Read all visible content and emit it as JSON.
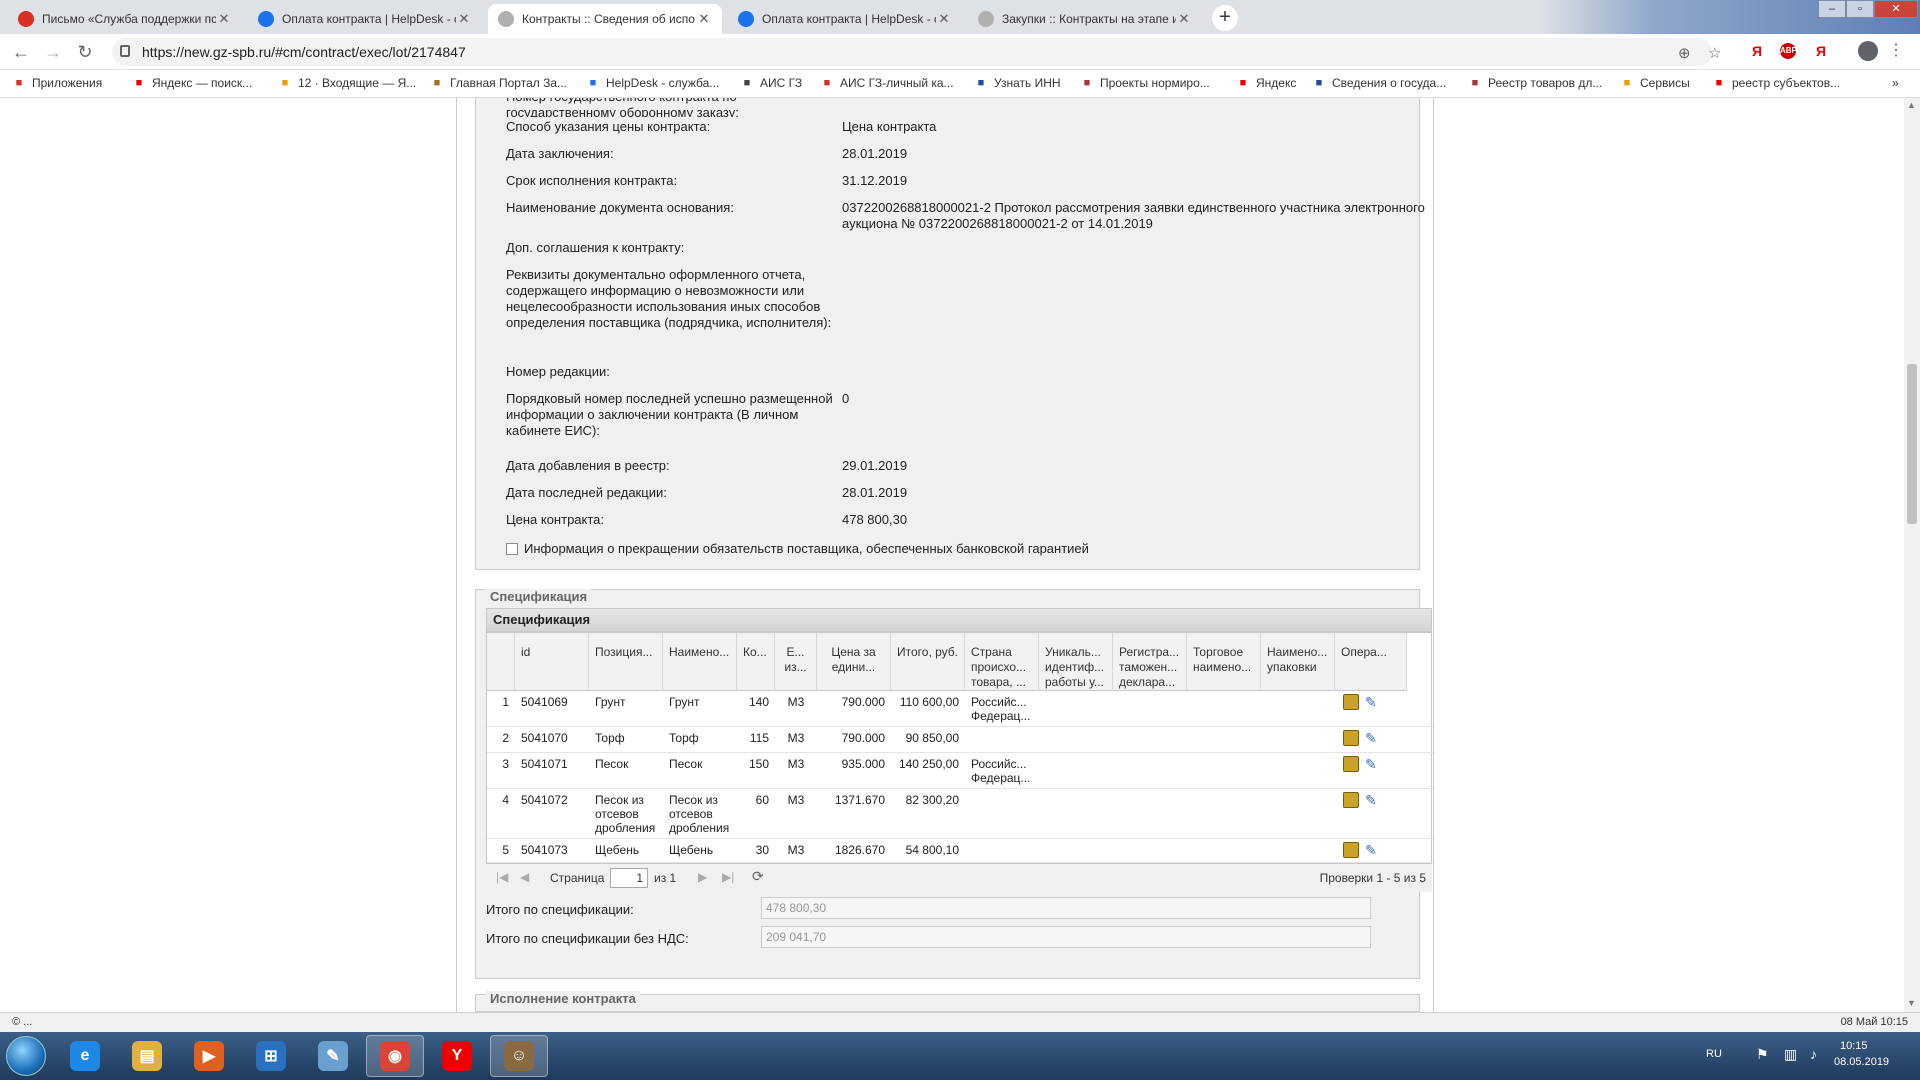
{
  "browser": {
    "tabs": [
      {
        "title": "Письмо «Служба поддержки пс",
        "icon_color": "#d93025",
        "icon": "mail-icon",
        "active": false
      },
      {
        "title": "Оплата контракта | HelpDesk - с",
        "icon_color": "#1a73e8",
        "icon": "helpdesk-icon",
        "active": false
      },
      {
        "title": "Контракты :: Сведения об испо",
        "icon_color": "#b0b0b0",
        "icon": "gz-icon",
        "active": true
      },
      {
        "title": "Оплата контракта | HelpDesk - с",
        "icon_color": "#1a73e8",
        "icon": "helpdesk-icon",
        "active": false
      },
      {
        "title": "Закупки :: Контракты на этапе и",
        "icon_color": "#b0b0b0",
        "icon": "gz-icon",
        "active": false
      }
    ],
    "new_tab": "+",
    "url": "https://new.gz-spb.ru/#cm/contract/exec/lot/2174847",
    "ext_labels": [
      "Я",
      "ABP",
      "Я"
    ],
    "bookmarks": [
      {
        "label": "Приложения",
        "icon": "apps-icon",
        "color": "#d93025"
      },
      {
        "label": "Яндекс — поиск...",
        "icon": "yandex-icon",
        "color": "#e00"
      },
      {
        "label": "12 · Входящие — Я...",
        "icon": "mail-icon",
        "color": "#e8a000"
      },
      {
        "label": "Главная Портал За...",
        "icon": "emblem-icon",
        "color": "#a07020"
      },
      {
        "label": "HelpDesk - служба...",
        "icon": "helpdesk-icon",
        "color": "#1a73e8"
      },
      {
        "label": "АИС ГЗ",
        "icon": "refresh-icon",
        "color": "#444"
      },
      {
        "label": "АИС ГЗ-личный ка...",
        "icon": "gz-icon",
        "color": "#c33"
      },
      {
        "label": "Узнать ИНН",
        "icon": "nalog-icon",
        "color": "#1a4f9c"
      },
      {
        "label": "Проекты нормиро...",
        "icon": "doc-icon",
        "color": "#a33"
      },
      {
        "label": "Яндекс",
        "icon": "yandex-icon",
        "color": "#e00"
      },
      {
        "label": "Сведения о госуда...",
        "icon": "globe-icon",
        "color": "#1a4f9c"
      },
      {
        "label": "Реестр товаров дл...",
        "icon": "registry-icon",
        "color": "#a33"
      },
      {
        "label": "Сервисы",
        "icon": "apps-icon",
        "color": "#e8a000"
      },
      {
        "label": "реестр субъектов...",
        "icon": "yandex-icon",
        "color": "#e00"
      }
    ],
    "more_bookmarks": "»"
  },
  "contract": {
    "top_cut_label": "Номер государственного контракта по государственному оборонному заказу:",
    "fields": [
      {
        "label": "Способ указания цены контракта:",
        "value": "Цена контракта"
      },
      {
        "label": "Дата заключения:",
        "value": "28.01.2019"
      },
      {
        "label": "Срок исполнения контракта:",
        "value": "31.12.2019"
      },
      {
        "label": "Наименование документа основания:",
        "value": "0372200268818000021-2 Протокол рассмотрения заявки единственного участника электронного аукциона № 0372200268818000021-2 от 14.01.2019"
      },
      {
        "label": "Доп. соглашения к контракту:",
        "value": ""
      },
      {
        "label": "Реквизиты документально оформленного отчета, содержащего информацию о невозможности или нецелесообразности использования иных способов определения поставщика (подрядчика, исполнителя):",
        "value": ""
      },
      {
        "label": "Номер редакции:",
        "value": ""
      },
      {
        "label": "Порядковый номер последней успешно размещенной информации о заключении контракта (В личном кабинете ЕИС):",
        "value": "0"
      },
      {
        "label": "Дата добавления в реестр:",
        "value": "29.01.2019"
      },
      {
        "label": "Дата последней редакции:",
        "value": "28.01.2019"
      },
      {
        "label": "Цена контракта:",
        "value": "478 800,30"
      }
    ],
    "checkbox_label": "Информация о прекращении обязательств поставщика, обеспеченных банковской гарантией"
  },
  "spec": {
    "legend": "Спецификация",
    "header": "Спецификация",
    "columns": [
      "",
      "id",
      "Позиция...",
      "Наимено...",
      "Ко...",
      "Е... из...",
      "Цена за едини...",
      "Итого, руб.",
      "Страна происхо... товара, ...",
      "Уникаль... идентиф... работы у...",
      "Регистра... таможен... деклара...",
      "Торговое наимено...",
      "Наимено... упаковки",
      "Опера..."
    ],
    "rows": [
      {
        "n": "1",
        "id": "5041069",
        "pos": "Грунт",
        "name": "Грунт",
        "qty": "140",
        "unit": "М3",
        "price": "790.000",
        "total": "110 600,00",
        "country": "Российс... Федерац..."
      },
      {
        "n": "2",
        "id": "5041070",
        "pos": "Торф",
        "name": "Торф",
        "qty": "115",
        "unit": "М3",
        "price": "790.000",
        "total": "90 850,00",
        "country": ""
      },
      {
        "n": "3",
        "id": "5041071",
        "pos": "Песок",
        "name": "Песок",
        "qty": "150",
        "unit": "М3",
        "price": "935.000",
        "total": "140 250,00",
        "country": "Российс... Федерац..."
      },
      {
        "n": "4",
        "id": "5041072",
        "pos": "Песок из отсевов дробления",
        "name": "Песок из отсевов дробления",
        "qty": "60",
        "unit": "М3",
        "price": "1371.670",
        "total": "82 300,20",
        "country": ""
      },
      {
        "n": "5",
        "id": "5041073",
        "pos": "Щебень",
        "name": "Щебень",
        "qty": "30",
        "unit": "М3",
        "price": "1826.670",
        "total": "54 800,10",
        "country": ""
      }
    ],
    "pager": {
      "page_label": "Страница",
      "page_value": "1",
      "of_label": "из 1",
      "summary": "Проверки 1 - 5 из 5"
    },
    "total_label": "Итого по спецификации:",
    "total_value": "478 800,30",
    "total_novat_label": "Итого по спецификации без НДС:",
    "total_novat_value": "209 041,70"
  },
  "next_section": "Исполнение контракта",
  "statusbar": {
    "left": "© ...",
    "right": "08 Май 10:15"
  },
  "taskbar": {
    "apps": [
      {
        "name": "ie",
        "glyph": "e",
        "color": "#1e88e5"
      },
      {
        "name": "explorer",
        "glyph": "▤",
        "color": "#e0b040"
      },
      {
        "name": "media",
        "glyph": "▶",
        "color": "#e06020"
      },
      {
        "name": "network",
        "glyph": "⊞",
        "color": "#2a70c0"
      },
      {
        "name": "paint",
        "glyph": "✎",
        "color": "#6aa0d0"
      },
      {
        "name": "chrome",
        "glyph": "◉",
        "color": "#db4437"
      },
      {
        "name": "yandex",
        "glyph": "Y",
        "color": "#e00"
      },
      {
        "name": "app",
        "glyph": "☺",
        "color": "#8a6a40"
      }
    ],
    "lang": "RU",
    "time": "10:15",
    "date": "08.05.2019"
  }
}
